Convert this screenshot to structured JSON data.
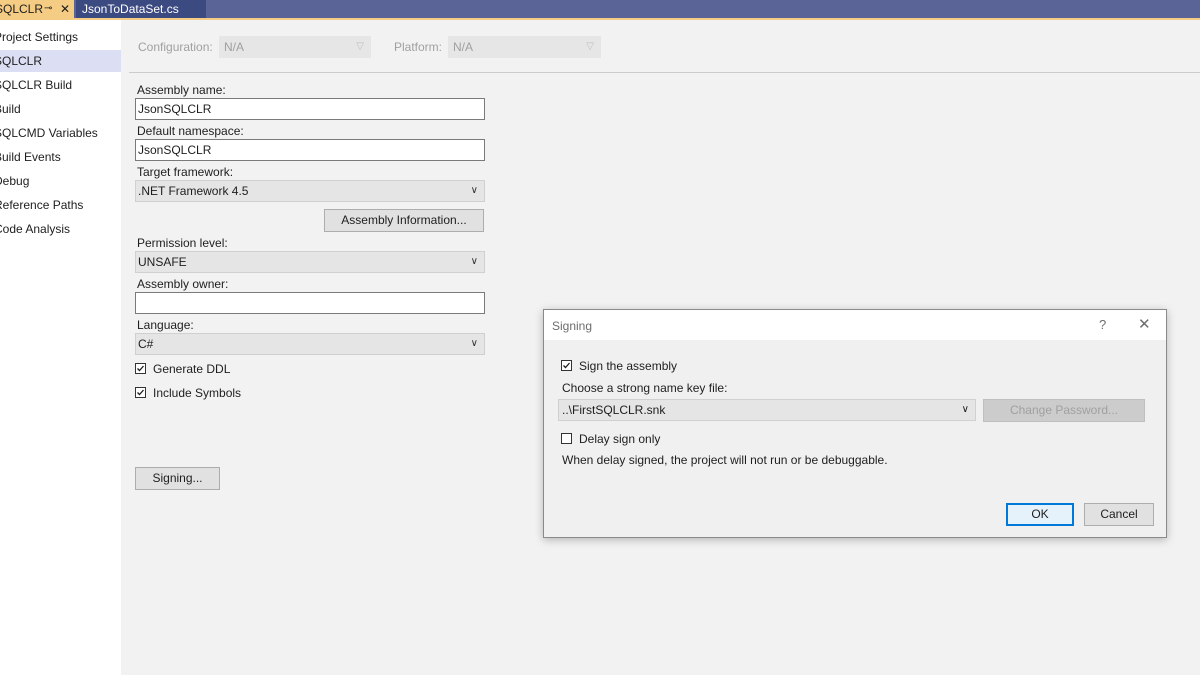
{
  "tabs": {
    "active_label": "SQLCLR",
    "active_pin_glyph": "⊸",
    "active_close_glyph": "✕",
    "inactive_label": "JsonToDataSet.cs"
  },
  "sidebar": {
    "items": [
      {
        "label": "Project Settings"
      },
      {
        "label": "SQLCLR"
      },
      {
        "label": "SQLCLR Build"
      },
      {
        "label": "Build"
      },
      {
        "label": "SQLCMD Variables"
      },
      {
        "label": "Build Events"
      },
      {
        "label": "Debug"
      },
      {
        "label": "Reference Paths"
      },
      {
        "label": "Code Analysis"
      }
    ],
    "selected_index": 1
  },
  "config": {
    "configuration_label": "Configuration:",
    "configuration_value": "N/A",
    "platform_label": "Platform:",
    "platform_value": "N/A"
  },
  "form": {
    "assembly_name_label": "Assembly name:",
    "assembly_name_value": "JsonSQLCLR",
    "default_namespace_label": "Default namespace:",
    "default_namespace_value": "JsonSQLCLR",
    "target_framework_label": "Target framework:",
    "target_framework_value": ".NET Framework 4.5",
    "assembly_info_button": "Assembly Information...",
    "permission_level_label": "Permission level:",
    "permission_level_value": "UNSAFE",
    "assembly_owner_label": "Assembly owner:",
    "assembly_owner_value": "",
    "language_label": "Language:",
    "language_value": "C#",
    "generate_ddl_label": "Generate DDL",
    "generate_ddl_checked": true,
    "include_symbols_label": "Include Symbols",
    "include_symbols_checked": true,
    "signing_button": "Signing..."
  },
  "dialog": {
    "title": "Signing",
    "help_glyph": "?",
    "close_glyph": "✕",
    "sign_assembly_label": "Sign the assembly",
    "sign_assembly_checked": true,
    "key_file_label": "Choose a strong name key file:",
    "key_file_value": "..\\FirstSQLCLR.snk",
    "change_password_button": "Change Password...",
    "delay_sign_label": "Delay sign only",
    "delay_sign_checked": false,
    "delay_note": "When delay signed, the project will not run or be debuggable.",
    "ok_button": "OK",
    "cancel_button": "Cancel"
  },
  "icons": {
    "chevron": "chevron-down-icon",
    "check": "checkmark-icon"
  },
  "colors": {
    "tab_strip": "#5a6496",
    "active_tab": "#f5cc84",
    "selected_nav": "#dcdff3",
    "ok_border": "#0078d7"
  }
}
